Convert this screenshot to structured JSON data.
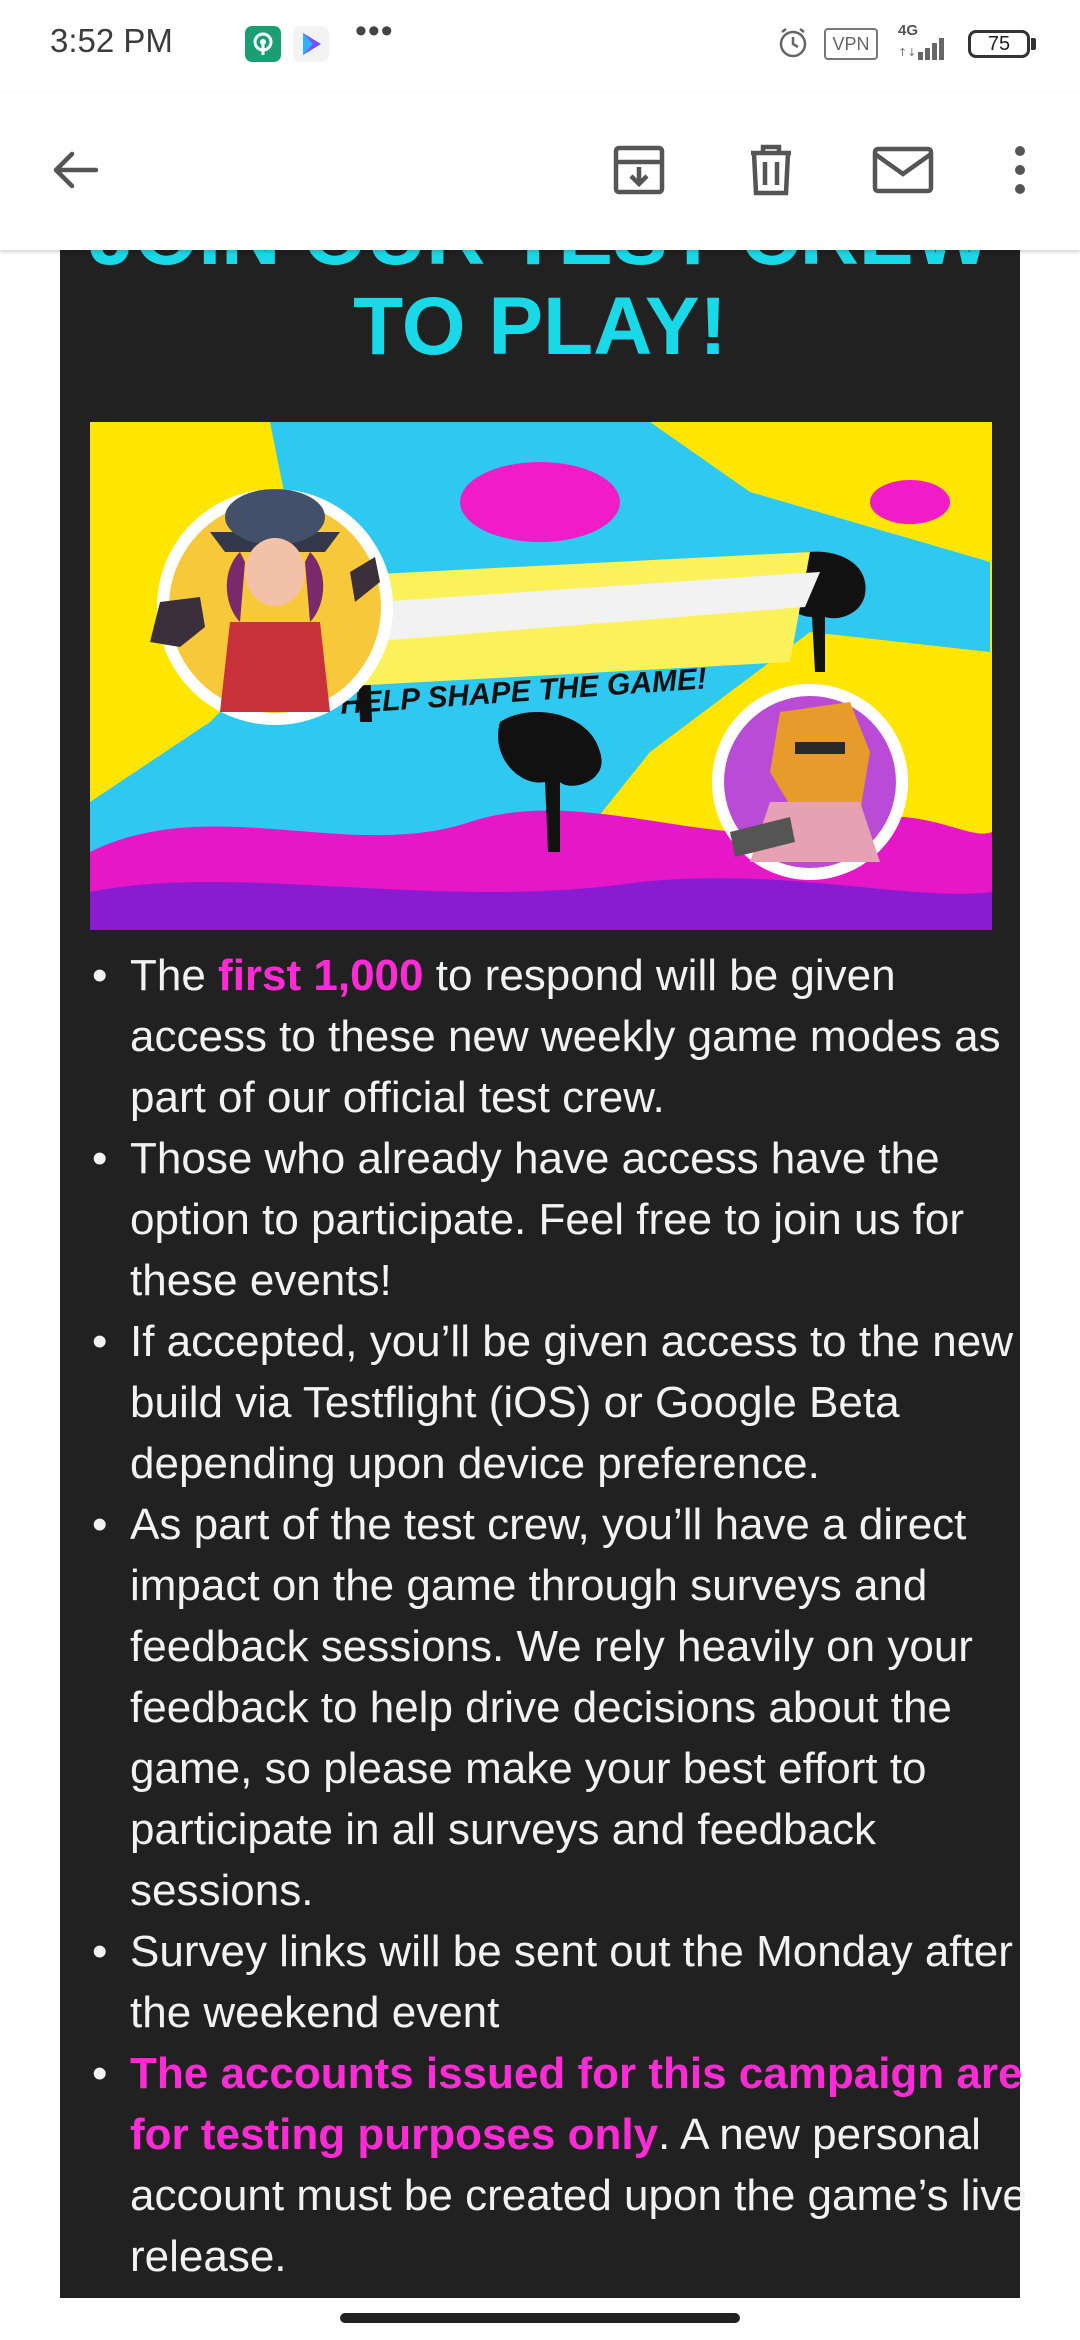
{
  "status_bar": {
    "time": "3:52 PM",
    "more": "•••",
    "vpn": "VPN",
    "network": "4G",
    "battery": "75"
  },
  "email": {
    "heading_line1": "JOIN OUR TEST CREW",
    "heading_line2": "TO PLAY!",
    "banner_text": "HELP SHAPE THE GAME!",
    "bullets": [
      {
        "pre": "The ",
        "highlight": "first 1,000",
        "post": " to respond will be given access to these new weekly game modes as part of our official test crew."
      },
      {
        "text": "Those who already have access have the option to participate. Feel free to join us for these events!"
      },
      {
        "text": "If accepted, you’ll be given access to the new build via Testflight (iOS) or Google Beta depending upon device preference."
      },
      {
        "text": "As part of the test crew, you’ll have a direct impact on the game through surveys and feedback sessions. We rely heavily on your feedback to help drive decisions about the game, so please make your best effort to participate in all surveys and feedback sessions."
      },
      {
        "text": "Survey links will be sent out the Monday after the weekend event"
      },
      {
        "highlight": "The accounts issued for this campaign are for testing purposes only",
        "post": ".  A new personal account must be created upon the game’s live release."
      }
    ]
  },
  "colors": {
    "heading": "#19d9e8",
    "highlight": "#ff2bd6",
    "card_bg": "#212121",
    "banner_yellow": "#ffe600",
    "banner_cyan": "#2ec8f0",
    "banner_magenta": "#f01cc8"
  },
  "icons": {
    "back": "arrow-left-icon",
    "archive": "archive-icon",
    "delete": "trash-icon",
    "mark_unread": "mail-icon",
    "more": "more-vert-icon"
  }
}
